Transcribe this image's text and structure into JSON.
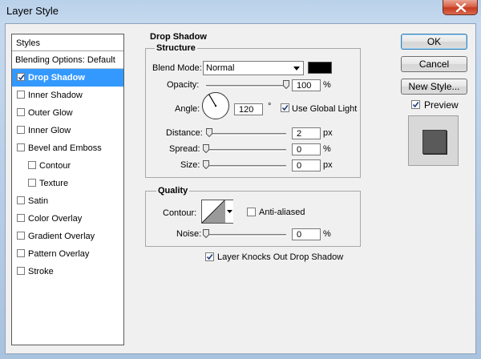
{
  "window": {
    "title": "Layer Style"
  },
  "styles": {
    "header": "Styles",
    "blending": "Blending Options: Default",
    "items": [
      {
        "label": "Drop Shadow",
        "checked": true,
        "selected": true,
        "indent": false
      },
      {
        "label": "Inner Shadow",
        "checked": false,
        "selected": false,
        "indent": false
      },
      {
        "label": "Outer Glow",
        "checked": false,
        "selected": false,
        "indent": false
      },
      {
        "label": "Inner Glow",
        "checked": false,
        "selected": false,
        "indent": false
      },
      {
        "label": "Bevel and Emboss",
        "checked": false,
        "selected": false,
        "indent": false
      },
      {
        "label": "Contour",
        "checked": false,
        "selected": false,
        "indent": true
      },
      {
        "label": "Texture",
        "checked": false,
        "selected": false,
        "indent": true
      },
      {
        "label": "Satin",
        "checked": false,
        "selected": false,
        "indent": false
      },
      {
        "label": "Color Overlay",
        "checked": false,
        "selected": false,
        "indent": false
      },
      {
        "label": "Gradient Overlay",
        "checked": false,
        "selected": false,
        "indent": false
      },
      {
        "label": "Pattern Overlay",
        "checked": false,
        "selected": false,
        "indent": false
      },
      {
        "label": "Stroke",
        "checked": false,
        "selected": false,
        "indent": false
      }
    ]
  },
  "drop_shadow": {
    "title": "Drop Shadow",
    "structure": {
      "title": "Structure",
      "blend_mode_label": "Blend Mode:",
      "blend_mode_value": "Normal",
      "shadow_color": "#000000",
      "opacity_label": "Opacity:",
      "opacity_value": "100",
      "opacity_unit": "%",
      "opacity_fraction": 1.0,
      "angle_label": "Angle:",
      "angle_value": "120",
      "angle_unit": "°",
      "use_global_light_label": "Use Global Light",
      "use_global_light_checked": true,
      "distance_label": "Distance:",
      "distance_value": "2",
      "distance_unit": "px",
      "spread_label": "Spread:",
      "spread_value": "0",
      "spread_unit": "%",
      "size_label": "Size:",
      "size_value": "0",
      "size_unit": "px"
    },
    "quality": {
      "title": "Quality",
      "contour_label": "Contour:",
      "anti_aliased_label": "Anti-aliased",
      "anti_aliased_checked": false,
      "noise_label": "Noise:",
      "noise_value": "0",
      "noise_unit": "%"
    },
    "knockout_label": "Layer Knocks Out Drop Shadow",
    "knockout_checked": true
  },
  "buttons": {
    "ok": "OK",
    "cancel": "Cancel",
    "new_style": "New Style..."
  },
  "preview": {
    "label": "Preview",
    "checked": true
  },
  "icons": {
    "close": "close-icon",
    "check": "check-icon",
    "dropdown": "chevron-down-icon",
    "dial": "angle-dial-icon",
    "thumb": "slider-thumb-icon"
  },
  "colors": {
    "selection": "#3399ff",
    "title_gradient_top": "#b9d1ea"
  }
}
